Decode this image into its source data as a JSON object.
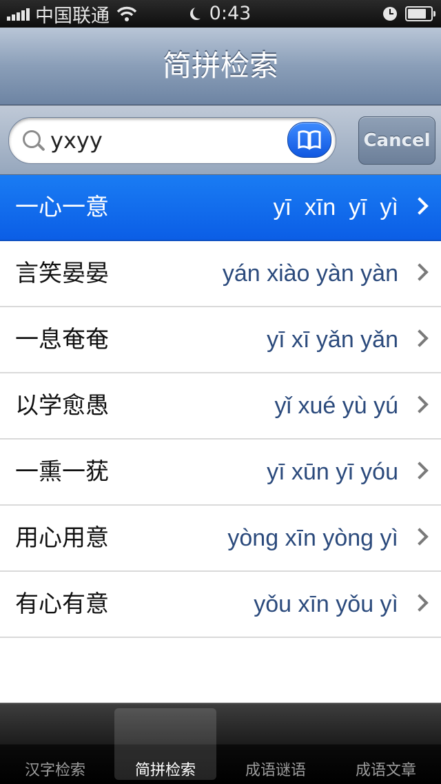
{
  "status_bar": {
    "carrier": "中国联通",
    "time": "0:43"
  },
  "nav": {
    "title": "简拼检索"
  },
  "search": {
    "value": "yxyy",
    "cancel_label": "Cancel"
  },
  "results": [
    {
      "idiom": "一心一意",
      "pinyin": "yī  xīn  yī  yì",
      "selected": true
    },
    {
      "idiom": "言笑晏晏",
      "pinyin": "yán xiào yàn yàn",
      "selected": false
    },
    {
      "idiom": "一息奄奄",
      "pinyin": "yī xī yǎn yǎn",
      "selected": false
    },
    {
      "idiom": "以学愈愚",
      "pinyin": "yǐ xué yù yú",
      "selected": false
    },
    {
      "idiom": "一熏一莸",
      "pinyin": "yī xūn yī yóu",
      "selected": false
    },
    {
      "idiom": "用心用意",
      "pinyin": "yòng xīn yòng yì",
      "selected": false
    },
    {
      "idiom": "有心有意",
      "pinyin": "yǒu xīn yǒu yì",
      "selected": false
    }
  ],
  "tabs": [
    {
      "label": "汉字检索",
      "active": false
    },
    {
      "label": "简拼检索",
      "active": true
    },
    {
      "label": "成语谜语",
      "active": false
    },
    {
      "label": "成语文章",
      "active": false
    }
  ],
  "colors": {
    "selected_row": "#0b5ee6",
    "pinyin_text": "#2b4a7c",
    "nav_bar": "#8a9eb8"
  },
  "icons": {
    "search": "magnifier-icon",
    "book": "book-icon",
    "disclosure": "chevron-right-icon"
  }
}
